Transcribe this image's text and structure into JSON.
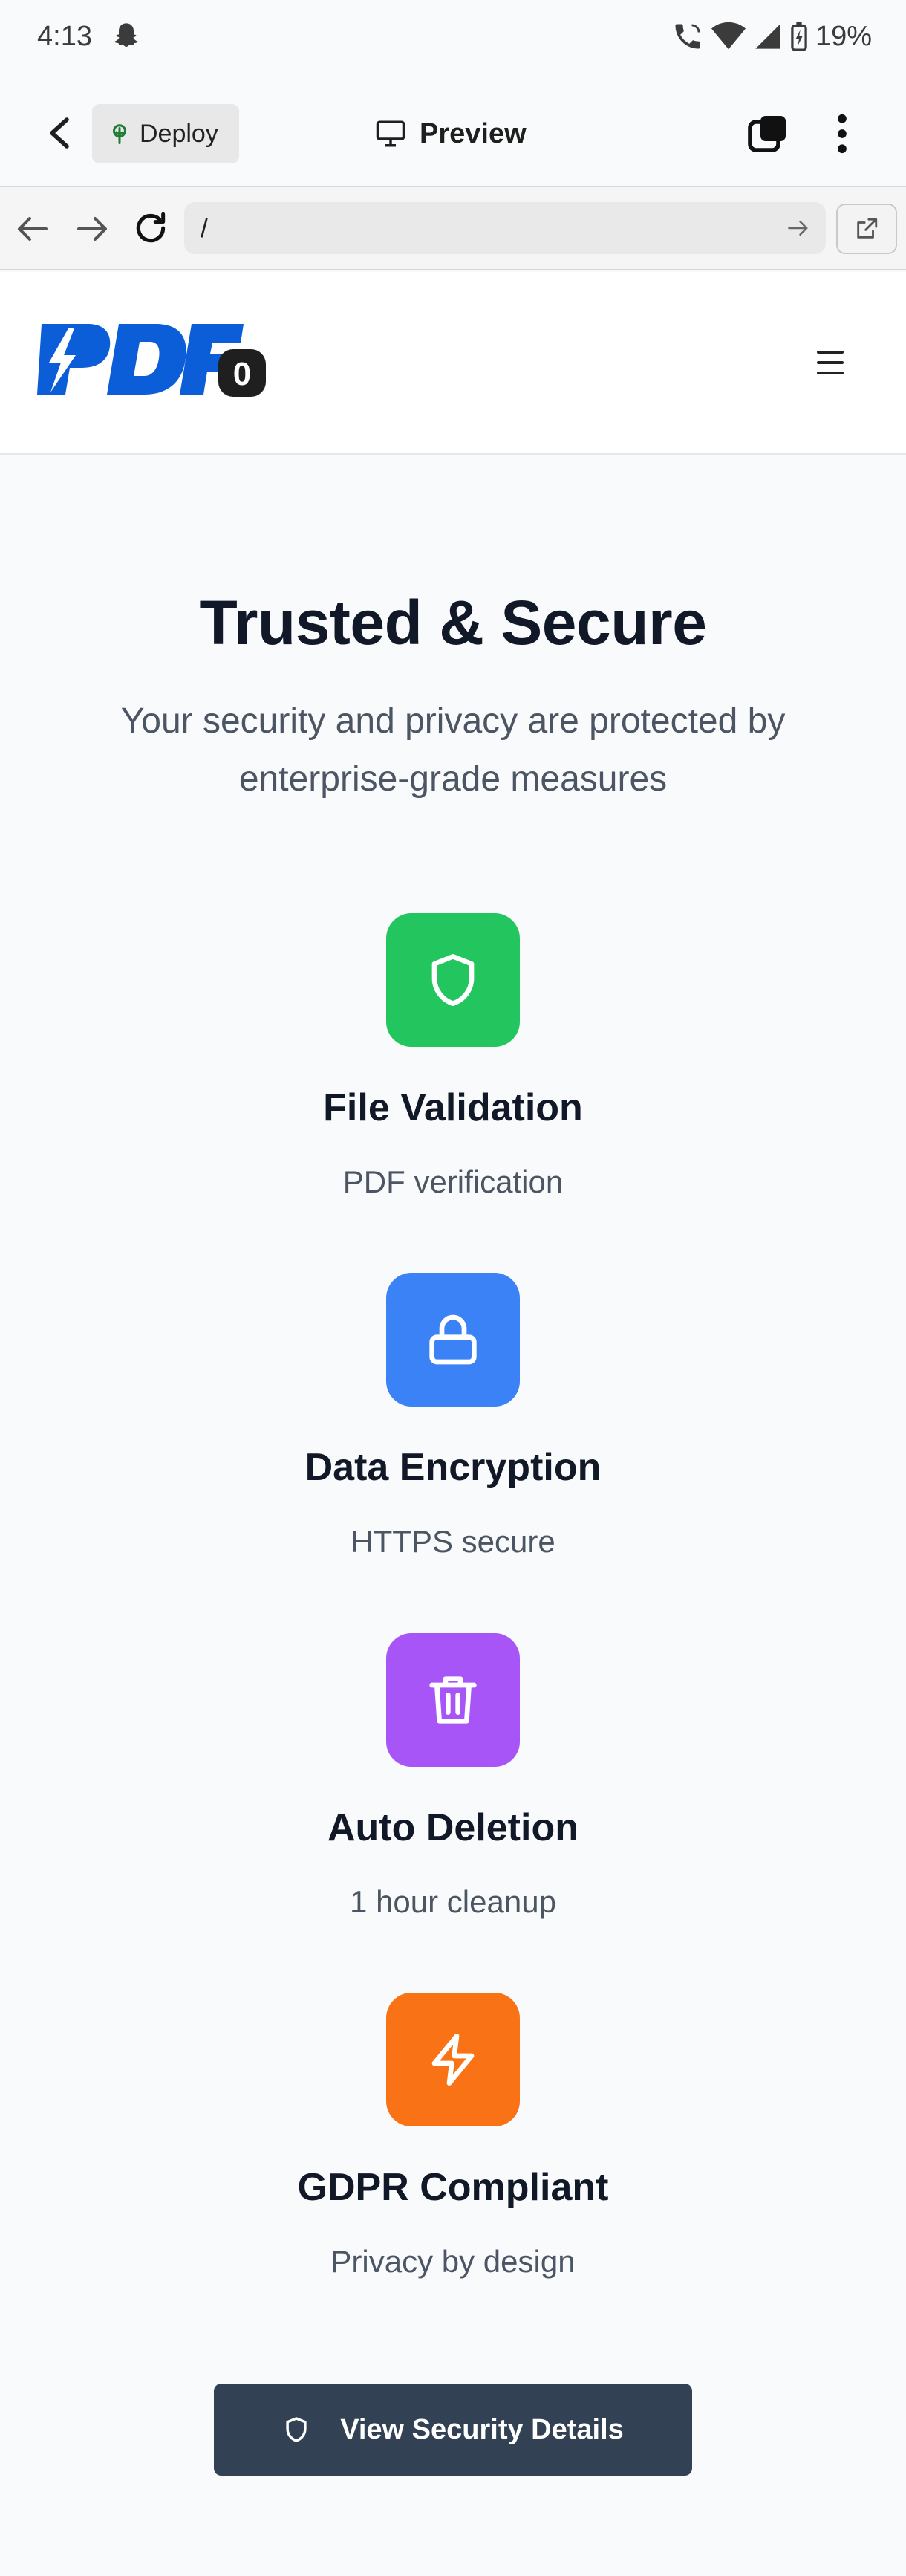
{
  "status_bar": {
    "time": "4:13",
    "battery": "19%",
    "icons": [
      "snapchat-icon",
      "wifi-call-icon",
      "wifi-icon",
      "signal-icon",
      "battery-icon"
    ]
  },
  "app_bar": {
    "deploy_label": "Deploy",
    "preview_label": "Preview",
    "icons": [
      "back-arrow-icon",
      "deploy-tree-icon",
      "monitor-icon",
      "tabs-icon",
      "more-vert-icon"
    ]
  },
  "url_bar": {
    "url": "/",
    "icons": [
      "nav-back-icon",
      "nav-forward-icon",
      "reload-icon",
      "go-arrow-icon",
      "open-external-icon"
    ]
  },
  "site_header": {
    "logo_text": "PDF",
    "logo_badge": "0",
    "menu_icon": "hamburger-icon"
  },
  "main": {
    "heading": "Trusted & Secure",
    "subheading": "Your security and privacy are protected by enterprise-grade measures",
    "features": [
      {
        "title": "File Validation",
        "desc": "PDF verification",
        "icon": "shield-icon",
        "color": "#22c55e"
      },
      {
        "title": "Data Encryption",
        "desc": "HTTPS secure",
        "icon": "lock-icon",
        "color": "#3b82f6"
      },
      {
        "title": "Auto Deletion",
        "desc": "1 hour cleanup",
        "icon": "trash-icon",
        "color": "#a855f7"
      },
      {
        "title": "GDPR Compliant",
        "desc": "Privacy by design",
        "icon": "zap-icon",
        "color": "#f97316"
      }
    ],
    "cta_label": "View Security Details",
    "cta_color": "#334155"
  },
  "colors": {
    "logo_blue": "#0b5ed7",
    "heading": "#111827",
    "body_text": "#4b5563",
    "page_bg": "#f9fafb"
  }
}
